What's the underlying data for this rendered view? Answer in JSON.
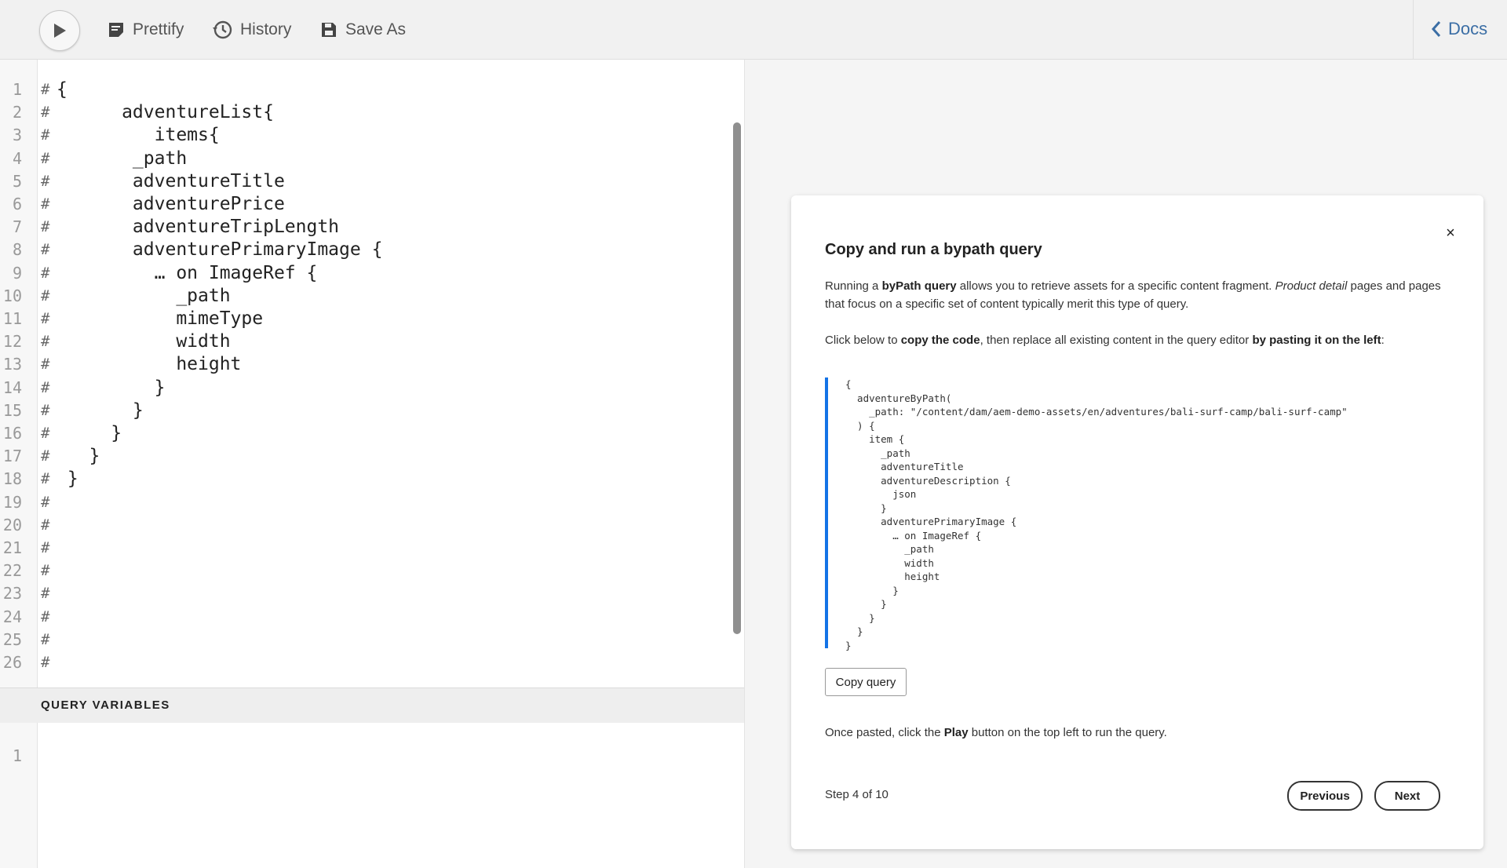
{
  "toolbar": {
    "prettify_label": "Prettify",
    "history_label": "History",
    "save_as_label": "Save As",
    "docs_label": "Docs"
  },
  "editor": {
    "lines": [
      {
        "n": "1",
        "prefix": "#",
        "code": "{"
      },
      {
        "n": "2",
        "prefix": "#",
        "code": "      adventureList{"
      },
      {
        "n": "3",
        "prefix": "#",
        "code": "         items{"
      },
      {
        "n": "4",
        "prefix": "#",
        "code": "       _path"
      },
      {
        "n": "5",
        "prefix": "#",
        "code": "       adventureTitle"
      },
      {
        "n": "6",
        "prefix": "#",
        "code": "       adventurePrice"
      },
      {
        "n": "7",
        "prefix": "#",
        "code": "       adventureTripLength"
      },
      {
        "n": "8",
        "prefix": "#",
        "code": "       adventurePrimaryImage {"
      },
      {
        "n": "9",
        "prefix": "#",
        "code": "         … on ImageRef {"
      },
      {
        "n": "10",
        "prefix": "#",
        "code": "           _path"
      },
      {
        "n": "11",
        "prefix": "#",
        "code": "           mimeType"
      },
      {
        "n": "12",
        "prefix": "#",
        "code": "           width"
      },
      {
        "n": "13",
        "prefix": "#",
        "code": "           height"
      },
      {
        "n": "14",
        "prefix": "#",
        "code": "         }"
      },
      {
        "n": "15",
        "prefix": "#",
        "code": "       }"
      },
      {
        "n": "16",
        "prefix": "#",
        "code": "     }"
      },
      {
        "n": "17",
        "prefix": "#",
        "code": "   }"
      },
      {
        "n": "18",
        "prefix": "#",
        "code": " }"
      },
      {
        "n": "19",
        "prefix": "#",
        "code": ""
      },
      {
        "n": "20",
        "prefix": "#",
        "code": ""
      },
      {
        "n": "21",
        "prefix": "#",
        "code": ""
      },
      {
        "n": "22",
        "prefix": "#",
        "code": ""
      },
      {
        "n": "23",
        "prefix": "#",
        "code": ""
      },
      {
        "n": "24",
        "prefix": "#",
        "code": ""
      },
      {
        "n": "25",
        "prefix": "#",
        "code": ""
      },
      {
        "n": "26",
        "prefix": "#",
        "code": ""
      }
    ]
  },
  "query_variables": {
    "title": "QUERY VARIABLES",
    "line_number": "1"
  },
  "tutorial": {
    "close_symbol": "×",
    "title": "Copy and run a bypath query",
    "para1": {
      "a": "Running a ",
      "b": "byPath query",
      "c": " allows you to retrieve assets for a specific content fragment. ",
      "d": "Product detail",
      "e": " pages and pages that focus on a specific set of content typically merit this type of query."
    },
    "para2": {
      "a": "Click below to ",
      "b": "copy the code",
      "c": ", then replace all existing content in the query editor ",
      "d": "by pasting it on the left",
      "e": ":"
    },
    "code": "{\n  adventureByPath(\n    _path: \"/content/dam/aem-demo-assets/en/adventures/bali-surf-camp/bali-surf-camp\"\n  ) {\n    item {\n      _path\n      adventureTitle\n      adventureDescription {\n        json\n      }\n      adventurePrimaryImage {\n        … on ImageRef {\n          _path\n          width\n          height\n        }\n      }\n    }\n  }\n}",
    "copy_label": "Copy query",
    "para3": {
      "a": "Once pasted, click the ",
      "b": "Play",
      "c": " button on the top left to run the query."
    },
    "step": "Step 4 of 10",
    "previous_label": "Previous",
    "next_label": "Next"
  },
  "colors": {
    "accent_blue": "#1473e6",
    "docs_link": "#3b6ea5"
  }
}
